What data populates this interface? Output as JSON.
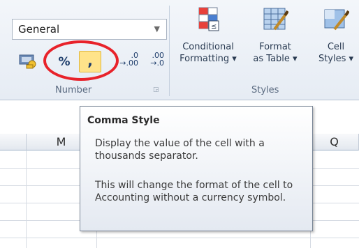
{
  "ribbon": {
    "number_group": {
      "format_value": "General",
      "label": "Number",
      "percent_label": "%",
      "comma_label": ",",
      "increase_decimal_label": [
        ".0",
        "→.00"
      ],
      "decrease_decimal_label": [
        ".00",
        "→.0"
      ]
    },
    "styles_group": {
      "label": "Styles",
      "conditional_formatting": [
        "Conditional",
        "Formatting ▾"
      ],
      "format_as_table": [
        "Format",
        "as Table ▾"
      ],
      "cell_styles": [
        "Cell",
        "Styles ▾"
      ]
    }
  },
  "sheet": {
    "columns": [
      "M",
      "Q"
    ]
  },
  "tooltip": {
    "title": "Comma Style",
    "paragraph1": "Display the value of the cell with a thousands separator.",
    "paragraph2": "This will change the format of the cell to Accounting without a currency symbol."
  },
  "colors": {
    "highlight_circle": "#e8222a",
    "active_button": "#ffe38a"
  }
}
